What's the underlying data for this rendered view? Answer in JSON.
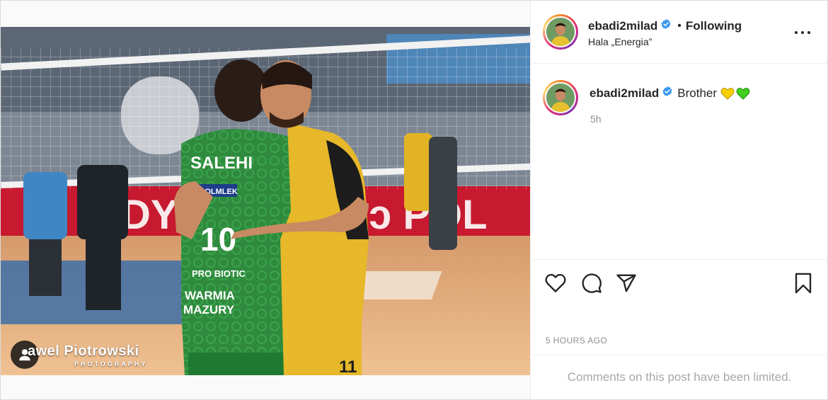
{
  "post": {
    "author": {
      "username": "ebadi2milad",
      "verified": true,
      "follow_status": "Following",
      "location": "Hala „Energia”"
    },
    "media": {
      "photo_credit_name": "awel Piotrowski",
      "photo_credit_sub": "PHOTOGRAPHY",
      "jersey_green": {
        "name": "SALEHI",
        "number": "10",
        "sponsor_lines": [
          "POLMLEK",
          "BIOTIC",
          "WARMIA",
          "MAZURY"
        ]
      },
      "jersey_yellow_number": "11",
      "banner_text": "INDYKPOL"
    },
    "caption": {
      "username": "ebadi2milad",
      "text": "Brother",
      "emojis": [
        "yellow-heart",
        "green-heart"
      ],
      "relative_time": "5h"
    },
    "actions": [
      "like",
      "comment",
      "share",
      "save"
    ],
    "timestamp": "5 HOURS AGO",
    "comments_notice": "Comments on this post have been limited.",
    "colors": {
      "verified_blue": "#3897f0",
      "muted_text": "#8e8e8e",
      "jersey_green": "#2f8a3d",
      "jersey_yellow": "#e6b82a"
    }
  }
}
